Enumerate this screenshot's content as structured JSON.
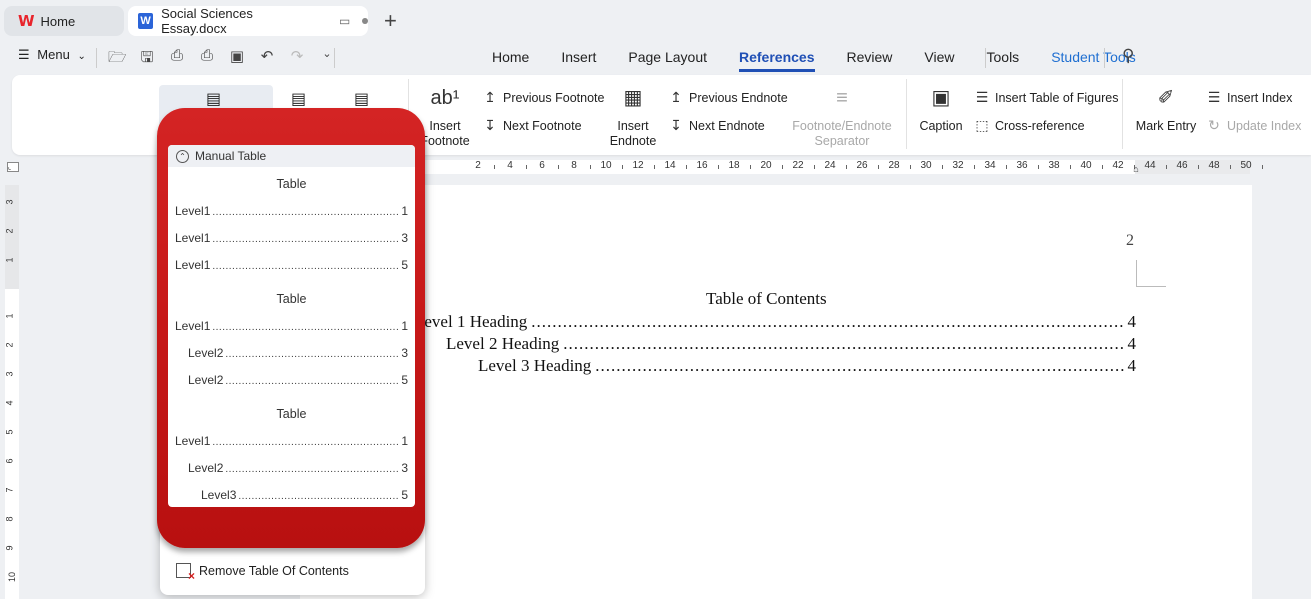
{
  "tabs": {
    "home_label": "Home",
    "doc_label": "Social Sciences Essay.docx",
    "new_tab_symbol": "+"
  },
  "menu": {
    "menu_label": "Menu",
    "ribbon_tabs": [
      "Home",
      "Insert",
      "Page Layout",
      "References",
      "Review",
      "View",
      "Tools"
    ],
    "active_tab": "References",
    "student_tools": "Student Tools"
  },
  "ribbon": {
    "insert_footnote": "Insert Footnote",
    "previous_footnote": "Previous Footnote",
    "next_footnote": "Next Footnote",
    "insert_endnote": "Insert Endnote",
    "previous_endnote": "Previous Endnote",
    "next_endnote": "Next Endnote",
    "footnote_separator": "Footnote/Endnote Separator",
    "caption": "Caption",
    "insert_table_of_figures": "Insert Table of Figures",
    "cross_reference": "Cross-reference",
    "mark_entry": "Mark Entry",
    "insert_index": "Insert Index",
    "update_index": "Update Index"
  },
  "ruler": {
    "h_ticks": [
      "2",
      "4",
      "6",
      "8",
      "10",
      "12",
      "14",
      "16",
      "18",
      "20",
      "22",
      "24",
      "26",
      "28",
      "30",
      "32",
      "34",
      "36",
      "38",
      "40",
      "42",
      "44",
      "46",
      "48",
      "50"
    ],
    "v_ticks_top": [
      "3",
      "2",
      "1"
    ],
    "v_ticks_bottom": [
      "1",
      "2",
      "3",
      "4",
      "5",
      "6",
      "7",
      "8",
      "9",
      "10"
    ]
  },
  "document": {
    "page_number": "2",
    "toc_title": "Table of Contents",
    "lines": [
      {
        "text": "Level 1 Heading",
        "page": "4"
      },
      {
        "text": "Level 2 Heading",
        "page": "4"
      },
      {
        "text": "Level 3 Heading",
        "page": "4"
      }
    ]
  },
  "dropdown": {
    "manual_table": "Manual Table",
    "groups": [
      {
        "title": "Table",
        "entries": [
          {
            "label": "Level1",
            "page": "1"
          },
          {
            "label": "Level1",
            "page": "3"
          },
          {
            "label": "Level1",
            "page": "5"
          }
        ]
      },
      {
        "title": "Table",
        "entries": [
          {
            "label": "Level1",
            "page": "1"
          },
          {
            "label": "Level2",
            "page": "3"
          },
          {
            "label": "Level2",
            "page": "5"
          }
        ]
      },
      {
        "title": "Table",
        "entries": [
          {
            "label": "Level1",
            "page": "1"
          },
          {
            "label": "Level2",
            "page": "3"
          },
          {
            "label": "Level3",
            "page": "5"
          }
        ]
      }
    ],
    "remove_label": "Remove Table Of Contents"
  },
  "colors": {
    "accent": "#1f4fb5",
    "annotation_red": "#c61818"
  }
}
